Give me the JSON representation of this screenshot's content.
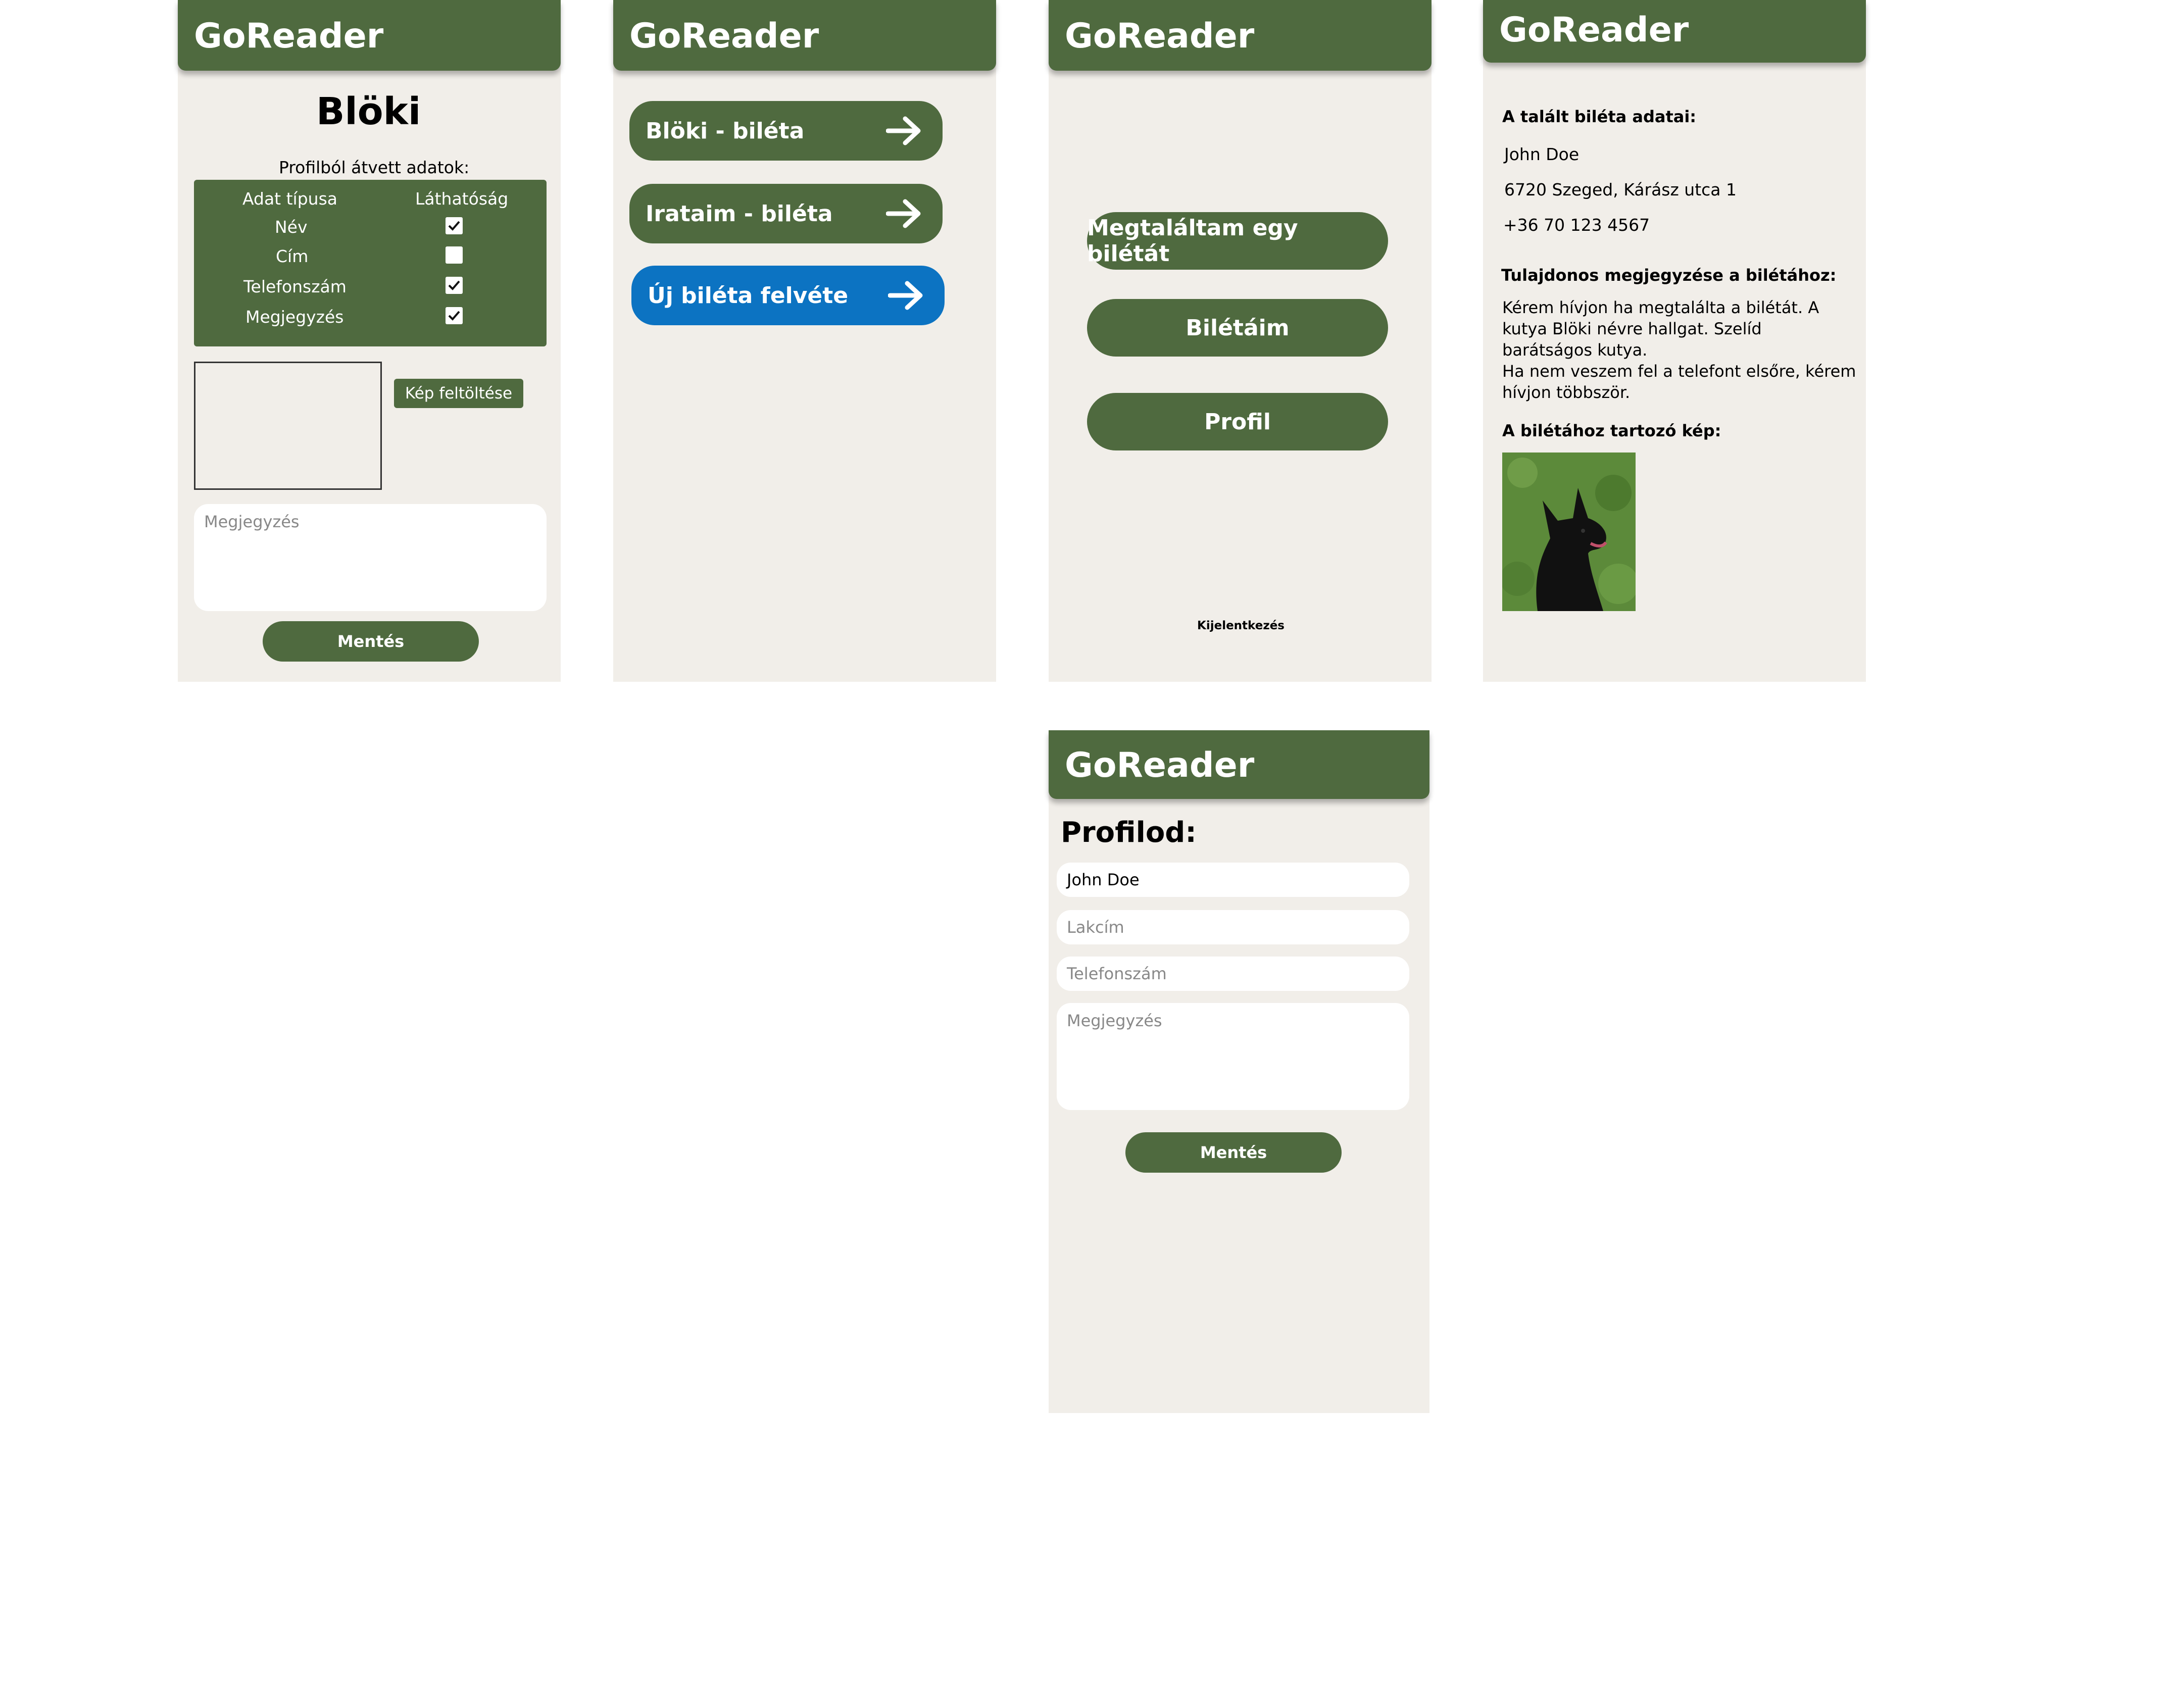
{
  "colors": {
    "primary_green": "#4f6a3f",
    "accent_blue": "#0c73c2",
    "screen_bg": "#f1eee9"
  },
  "app_title": "GoReader",
  "screen1": {
    "page_title": "Blöki",
    "section_label": "Profilból átvett adatok:",
    "table": {
      "headers": [
        "Adat típusa",
        "Láthatóság"
      ],
      "rows": [
        {
          "label": "Név",
          "checked": true
        },
        {
          "label": "Cím",
          "checked": false
        },
        {
          "label": "Telefonszám",
          "checked": true
        },
        {
          "label": "Megjegyzés",
          "checked": true
        }
      ]
    },
    "upload_button": "Kép feltöltése",
    "note_placeholder": "Megjegyzés",
    "save_button": "Mentés"
  },
  "screen2": {
    "items": [
      {
        "label": "Blöki - biléta",
        "icon": "arrow-right-icon"
      },
      {
        "label": "Irataim - biléta",
        "icon": "arrow-right-icon"
      },
      {
        "label": "Új biléta felvéte",
        "icon": "arrow-right-icon"
      }
    ]
  },
  "screen3": {
    "found_button": "Megtaláltam egy bilétát",
    "my_tags_button": "Bilétáim",
    "profile_button": "Profil",
    "logout_link": "Kijelentkezés"
  },
  "screen4": {
    "found_heading": "A talált biléta adatai:",
    "owner_name": "John Doe",
    "owner_address": "6720 Szeged, Kárász utca 1",
    "owner_phone": "+36 70 123 4567",
    "note_heading": "Tulajdonos megjegyzése a bilétához:",
    "note_lines": [
      "Kérem hívjon ha megtalálta a bilétát. A",
      "kutya Blöki névre hallgat. Szelíd",
      "barátságos kutya.",
      "Ha nem veszem fel a telefont elsőre, kérem",
      "hívjon többször."
    ],
    "image_heading": "A bilétához tartozó kép:"
  },
  "screen5": {
    "page_title": "Profilod:",
    "name_value": "John Doe",
    "address_placeholder": "Lakcím",
    "phone_placeholder": "Telefonszám",
    "note_placeholder": "Megjegyzés",
    "save_button": "Mentés"
  }
}
